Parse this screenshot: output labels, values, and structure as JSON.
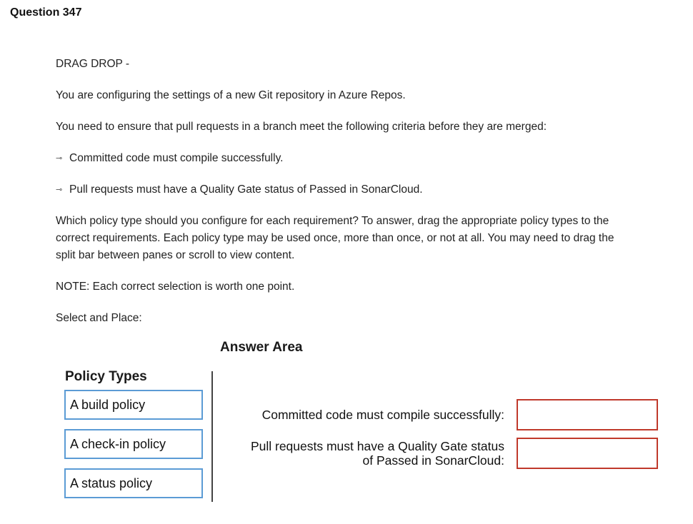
{
  "question": {
    "title": "Question 347",
    "type_label": "DRAG DROP -",
    "intro": "You are configuring the settings of a new Git repository in Azure Repos.",
    "criteria_intro": "You need to ensure that pull requests in a branch meet the following criteria before they are merged:",
    "bullets": [
      "Committed code must compile successfully.",
      "Pull requests must have a Quality Gate status of Passed in SonarCloud."
    ],
    "bullet_icon": "⊸",
    "instructions_line1": "Which policy type should you configure for each requirement? To answer, drag the appropriate policy types to the",
    "instructions_line2": "correct requirements. Each policy type may be used once, more than once, or not at all. You may need to drag the",
    "instructions_line3": "split bar between panes or scroll to view content.",
    "note": "NOTE: Each correct selection is worth one point.",
    "select_place": "Select and Place:"
  },
  "exhibit": {
    "answer_area_title": "Answer Area",
    "policy_types_title": "Policy Types",
    "policy_types": [
      "A build policy",
      "A check-in policy",
      "A status policy"
    ],
    "requirements": [
      {
        "line1": "Committed code must compile successfully:",
        "line2": ""
      },
      {
        "line1": "Pull requests must have a Quality Gate status",
        "line2": "of Passed in SonarCloud:"
      }
    ],
    "colors": {
      "source_border": "#5b9bd5",
      "target_border": "#c0392b"
    }
  }
}
